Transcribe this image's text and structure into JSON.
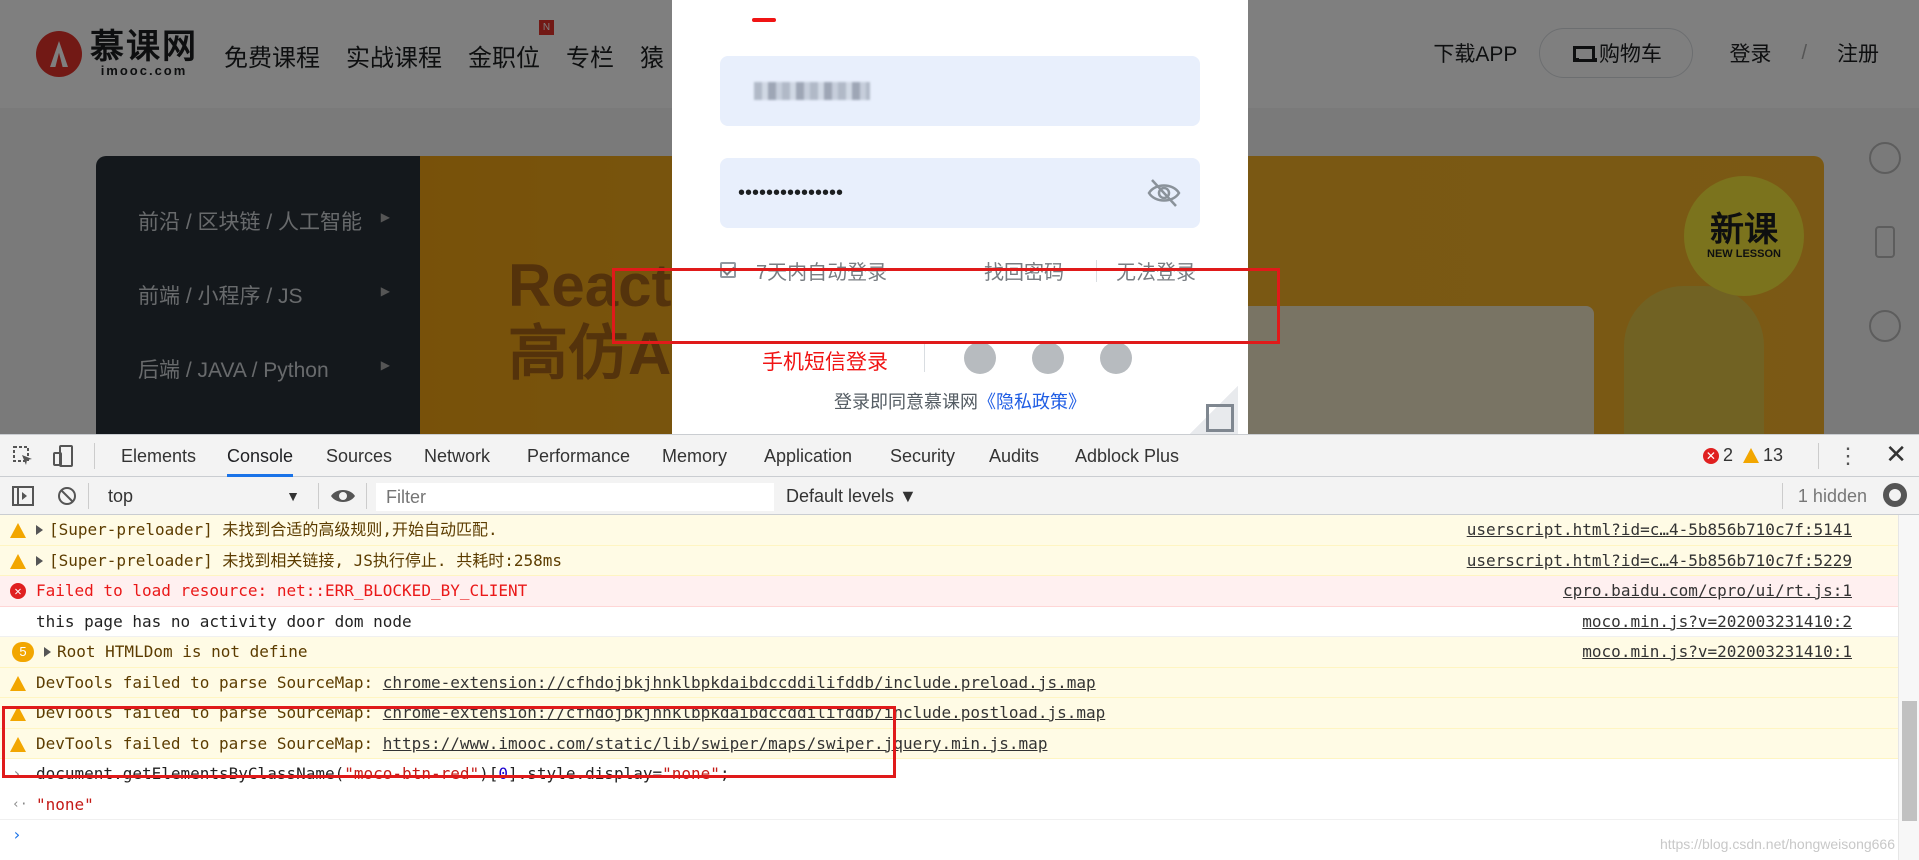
{
  "site": {
    "logo_cn": "慕课网",
    "logo_en": "imooc.com",
    "nav": [
      "免费课程",
      "实战课程",
      "金职位",
      "专栏",
      "猿"
    ],
    "nav_badge": "N",
    "download_app": "下载APP",
    "cart": "购物车",
    "login": "登录",
    "separator": "/",
    "register": "注册"
  },
  "banner": {
    "categories": [
      "前沿 / 区块链 / 人工智能",
      "前端 / 小程序 / JS",
      "后端 / JAVA / Python"
    ],
    "title_line1": "React",
    "title_line2": "高仿A",
    "new_badge_cn": "新课",
    "new_badge_en": "NEW LESSON"
  },
  "login_modal": {
    "password_value": "•••••••••••••••",
    "auto_login": "7天内自动登录",
    "forgot_password": "找回密码",
    "cannot_login": "无法登录",
    "sms_login": "手机短信登录",
    "agree_prefix": "登录即同意慕课网",
    "privacy_link": "《隐私政策》"
  },
  "devtools": {
    "tabs": [
      "Elements",
      "Console",
      "Sources",
      "Network",
      "Performance",
      "Memory",
      "Application",
      "Security",
      "Audits",
      "Adblock Plus"
    ],
    "active_tab": "Console",
    "error_count": "2",
    "warning_count": "13",
    "context": "top",
    "filter_placeholder": "Filter",
    "levels": "Default levels ▼",
    "hidden": "1 hidden",
    "messages": [
      {
        "type": "warn",
        "text": "[Super-preloader] 未找到合适的高级规则,开始自动匹配.",
        "src": "userscript.html?id=c…4-5b856b710c7f:5141"
      },
      {
        "type": "warn",
        "text": "[Super-preloader] 未找到相关链接, JS执行停止. 共耗时:258ms",
        "src": "userscript.html?id=c…4-5b856b710c7f:5229"
      },
      {
        "type": "error",
        "text": "Failed to load resource: net::ERR_BLOCKED_BY_CLIENT",
        "src": "cpro.baidu.com/cpro/ui/rt.js:1"
      },
      {
        "type": "info",
        "text": "this page has no activity door dom node",
        "src": "moco.min.js?v=202003231410:2"
      },
      {
        "type": "repeat",
        "count": "5",
        "text": "Root HTMLDom is not define",
        "src": "moco.min.js?v=202003231410:1"
      },
      {
        "type": "warn",
        "prefix": "DevTools failed to parse SourceMap: ",
        "link": "chrome-extension://cfhdojbkjhnklbpkdaibdccddilifddb/include.preload.js.map"
      },
      {
        "type": "warn",
        "prefix": "DevTools failed to parse SourceMap: ",
        "link": "chrome-extension://cfhdojbkjhnklbpkdaibdccddilifddb/include.postload.js.map"
      },
      {
        "type": "warn",
        "prefix": "DevTools failed to parse SourceMap: ",
        "link": "https://www.imooc.com/static/lib/swiper/maps/swiper.jquery.min.js.map"
      }
    ],
    "command": {
      "part1": "document.getElementsByClassName(",
      "str1": "\"moco-btn-red\"",
      "part2": ")[",
      "num": "0",
      "part3": "].style.display=",
      "str2": "\"none\"",
      "part4": ";"
    },
    "result": "\"none\"",
    "watermark": "https://blog.csdn.net/hongweisong666"
  },
  "colors": {
    "accent_red": "#f01414",
    "highlight_box": "#e01a1a",
    "link_blue": "#1f5de4",
    "devtools_active": "#1a73e8"
  }
}
